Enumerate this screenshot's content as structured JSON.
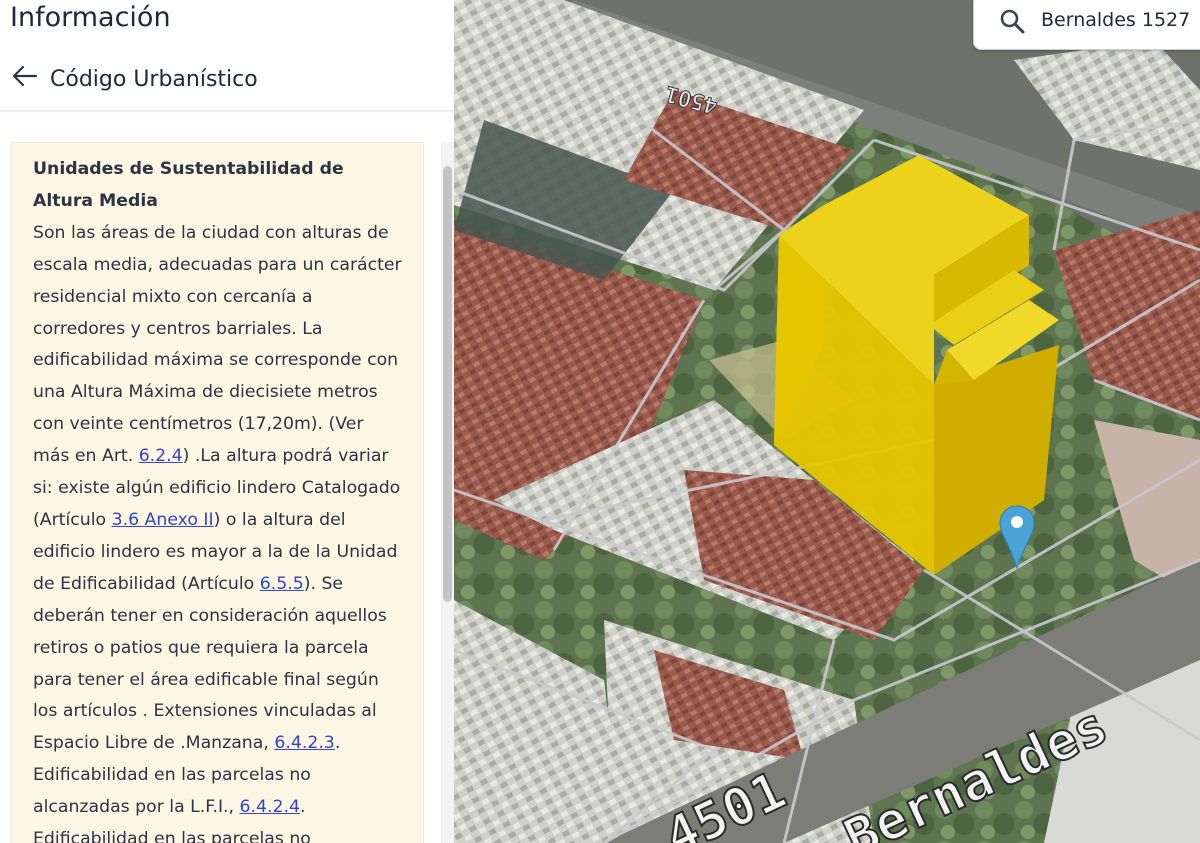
{
  "panel": {
    "title": "Información",
    "section_title": "Código Urbanístico"
  },
  "content": {
    "title": "Unidades de Sustentabilidad de Altura Media",
    "p1": "Son las áreas de la ciudad con alturas de escala media, adecuadas para un carácter residencial mixto con cercanía a corredores y centros barriales. La edificabilidad máxima se corresponde con una Altura Máxima de diecisiete metros con veinte centímetros (17,20m). (Ver más en Art. ",
    "link1": "6.2.4",
    "p2": ") .La altura podrá variar si: existe algún edificio lindero Catalogado (Artículo ",
    "link2": "3.6 Anexo II",
    "p3": ") o la altura del edificio lindero es mayor a la de la Unidad de Edificabilidad (Artículo ",
    "link3": "6.5.5",
    "p4": "). Se deberán tener en consideración aquellos retiros o patios que requiera la parcela para tener el área edificable final según los artículos . Extensiones vinculadas al Espacio Libre de .Manzana, ",
    "link4": "6.4.2.3",
    "p5": ". Edificabilidad en las parcelas no alcanzadas por la L.F.I., ",
    "link5": "6.4.2.4",
    "p6": ". Edificabilidad en las parcelas no"
  },
  "search": {
    "value": "Bernaldes 1527"
  },
  "map": {
    "street_label_top": "4501",
    "street_label_bottom_number": "4501",
    "street_label_bottom_name": "Bernaldes",
    "building_color": "#e6c600",
    "marker_color": "#4aa3d6"
  },
  "colors": {
    "link": "#3443c9",
    "card_bg": "#fbf7e4",
    "text": "#2b3440"
  }
}
